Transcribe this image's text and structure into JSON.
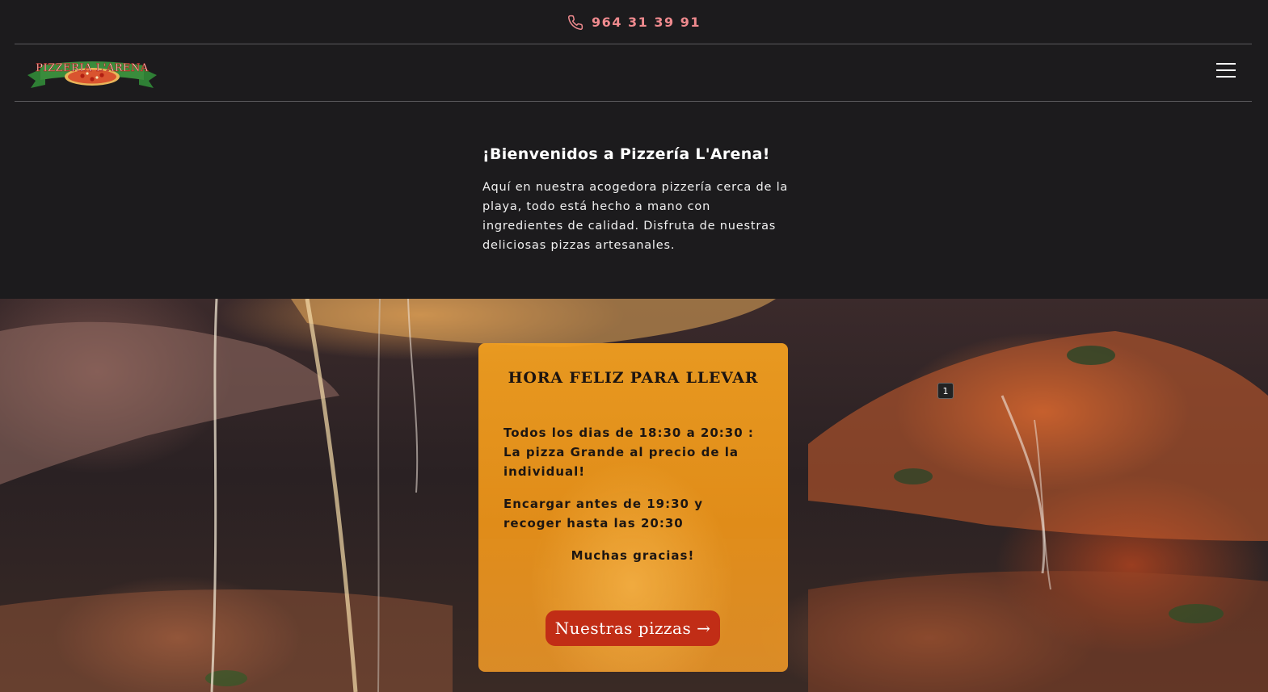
{
  "header": {
    "phone": "964 31 39 91",
    "phone_icon": "phone-icon",
    "accent_color": "#ef8a8e"
  },
  "nav": {
    "logo_text": "PIZZERIA L'ARENA",
    "menu_icon": "hamburger-menu-icon"
  },
  "intro": {
    "title": "¡Bienvenidos a Pizzería L'Arena!",
    "text": "Aquí en nuestra acogedora pizzería cerca de la playa, todo está hecho a mano con ingredientes de calidad. Disfruta de nuestras deliciosas pizzas artesanales."
  },
  "promo": {
    "title": "HORA FELIZ PARA LLEVAR",
    "line1": "Todos los dias de 18:30 a 20:30 : La pizza Grande al precio de la individual!",
    "line2": "Encargar antes de 19:30 y recoger hasta las 20:30",
    "line3": "Muchas gracias!",
    "cta_label": "Nuestras pizzas →",
    "card_color": "#f3a020",
    "cta_color": "#c12d16"
  },
  "overlay_badge": "1"
}
